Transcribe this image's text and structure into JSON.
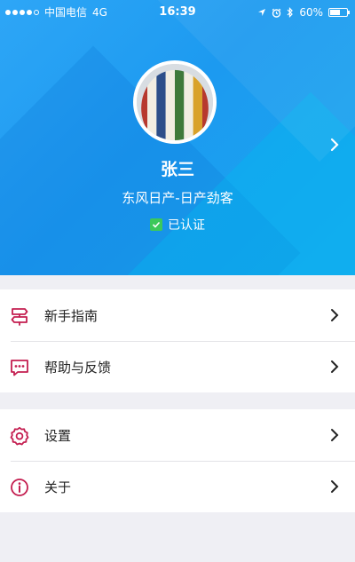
{
  "status_bar": {
    "carrier": "中国电信",
    "network": "4G",
    "time": "16:39",
    "battery_percent": "60%",
    "battery_level": 0.6,
    "signal_bars": 4
  },
  "profile": {
    "name": "张三",
    "company": "东风日产-日产劲客",
    "verified_label": "已认证"
  },
  "menu": {
    "groups": [
      {
        "items": [
          {
            "label": "新手指南",
            "icon": "signpost-icon"
          },
          {
            "label": "帮助与反馈",
            "icon": "chat-icon"
          }
        ]
      },
      {
        "items": [
          {
            "label": "设置",
            "icon": "gear-icon"
          },
          {
            "label": "关于",
            "icon": "info-icon"
          }
        ]
      }
    ]
  },
  "colors": {
    "header_blue": "#1c9af0",
    "icon_accent": "#c41e50",
    "verified_green": "#3cc85a",
    "background": "#efeff4"
  }
}
